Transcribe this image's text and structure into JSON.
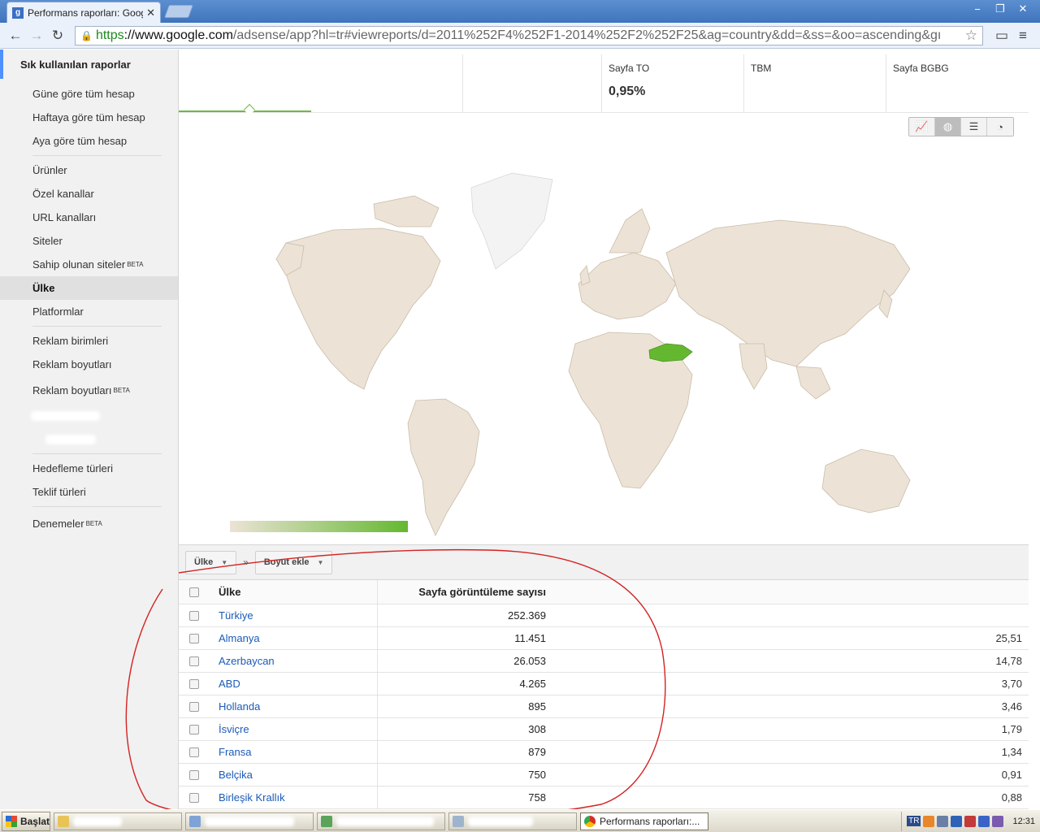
{
  "browser": {
    "tab_title": "Performans raporları: Google",
    "tab_close": "✕",
    "url_scheme": "https",
    "url_host": "://www.google.com",
    "url_path": "/adsense/app?hl=tr#viewreports/d=2011%252F4%252F1-2014%252F2%252F25&ag=country&dd=&ss=&oo=ascending&gı",
    "window_controls": [
      "−",
      "❐",
      "✕"
    ]
  },
  "sidebar": {
    "title": "Sık kullanılan raporlar",
    "items": [
      {
        "label": "Güne göre tüm hesap"
      },
      {
        "label": "Haftaya göre tüm hesap"
      },
      {
        "label": "Aya göre tüm hesap"
      },
      {
        "label": "Ürünler"
      },
      {
        "label": "Özel kanallar"
      },
      {
        "label": "URL kanalları"
      },
      {
        "label": "Siteler"
      },
      {
        "label": "Sahip olunan siteler",
        "sup": "BETA"
      },
      {
        "label": "Ülke"
      },
      {
        "label": "Platformlar"
      },
      {
        "label": "Reklam birimleri"
      },
      {
        "label": "Reklam boyutları"
      },
      {
        "label": "Reklam boyutları",
        "sup": "BETA"
      },
      {
        "label": "Hedefleme türleri"
      },
      {
        "label": "Teklif türleri"
      },
      {
        "label": "Denemeler",
        "sup": "BETA"
      }
    ]
  },
  "metrics": {
    "page_ctr_label": "Sayfa TO",
    "page_ctr_value": "0,95%",
    "cpc_label": "TBM",
    "page_rpm_label": "Sayfa BGBG"
  },
  "colors": {
    "accent_green": "#6dba40",
    "highlight_country": "#64b830",
    "land": "#ece3d6",
    "link": "#1a5bb8",
    "annotation": "#d42222"
  },
  "view_icons": [
    "line-chart-icon",
    "globe-icon",
    "bar-list-icon",
    "pie-icon"
  ],
  "filters": {
    "dimension": "Ülke",
    "add_dimension": "Boyut ekle",
    "separator": "»"
  },
  "table": {
    "col_country": "Ülke",
    "col_pageviews": "Sayfa görüntüleme sayısı",
    "rows": [
      {
        "country": "Türkiye",
        "views": "252.369",
        "last": ""
      },
      {
        "country": "Almanya",
        "views": "11.451",
        "last": "25,51"
      },
      {
        "country": "Azerbaycan",
        "views": "26.053",
        "last": "14,78"
      },
      {
        "country": "ABD",
        "views": "4.265",
        "last": "3,70"
      },
      {
        "country": "Hollanda",
        "views": "895",
        "last": "3,46"
      },
      {
        "country": "İsviçre",
        "views": "308",
        "last": "1,79"
      },
      {
        "country": "Fransa",
        "views": "879",
        "last": "1,34"
      },
      {
        "country": "Belçika",
        "views": "750",
        "last": "0,91"
      },
      {
        "country": "Birleşik Krallık",
        "views": "758",
        "last": "0,88"
      }
    ]
  },
  "taskbar": {
    "start": "Başlat",
    "active_window": "Performans raporları:...",
    "lang": "TR",
    "clock": "12:31"
  }
}
